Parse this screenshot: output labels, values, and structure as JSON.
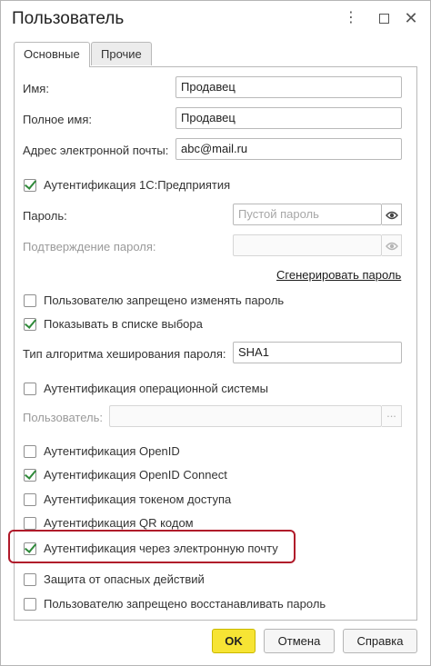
{
  "window": {
    "title": "Пользователь",
    "more_glyph": "⋮",
    "close_glyph": "✕"
  },
  "tabs": [
    {
      "label": "Основные",
      "active": true
    },
    {
      "label": "Прочие",
      "active": false
    }
  ],
  "fields": {
    "name": {
      "label": "Имя:",
      "value": "Продавец"
    },
    "full_name": {
      "label": "Полное имя:",
      "value": "Продавец"
    },
    "email": {
      "label": "Адрес электронной почты:",
      "value": "abc@mail.ru"
    },
    "password": {
      "label": "Пароль:",
      "placeholder": "Пустой пароль"
    },
    "password_confirm": {
      "label": "Подтверждение пароля:"
    },
    "hash_algo": {
      "label": "Тип алгоритма хеширования пароля:",
      "value": "SHA1"
    },
    "os_user": {
      "label": "Пользователь:",
      "button": "..."
    }
  },
  "links": {
    "generate_password": "Сгенерировать пароль"
  },
  "checkboxes": {
    "auth_1c": {
      "label": "Аутентификация 1С:Предприятия",
      "checked": true
    },
    "forbid_change_password": {
      "label": "Пользователю запрещено изменять пароль",
      "checked": false
    },
    "show_in_list": {
      "label": "Показывать в списке выбора",
      "checked": true
    },
    "auth_os": {
      "label": "Аутентификация операционной системы",
      "checked": false
    },
    "auth_openid": {
      "label": "Аутентификация OpenID",
      "checked": false
    },
    "auth_openid_connect": {
      "label": "Аутентификация OpenID Connect",
      "checked": true
    },
    "auth_token": {
      "label": "Аутентификация токеном доступа",
      "checked": false
    },
    "auth_qr": {
      "label": "Аутентификация QR кодом",
      "checked": false
    },
    "auth_email": {
      "label": "Аутентификация через электронную почту",
      "checked": true
    },
    "protect_dangerous": {
      "label": "Защита от опасных действий",
      "checked": false
    },
    "forbid_restore_password": {
      "label": "Пользователю запрещено восстанавливать пароль",
      "checked": false
    }
  },
  "buttons": {
    "ok": "OK",
    "cancel": "Отмена",
    "help": "Справка"
  },
  "colors": {
    "ok_button": "#f7e434",
    "highlight_border": "#b01a2a",
    "check_mark": "#2f8a3a"
  },
  "icons": {
    "eye": "eye-icon",
    "more": "more-vertical-icon",
    "maximize": "maximize-icon",
    "close": "close-icon"
  }
}
